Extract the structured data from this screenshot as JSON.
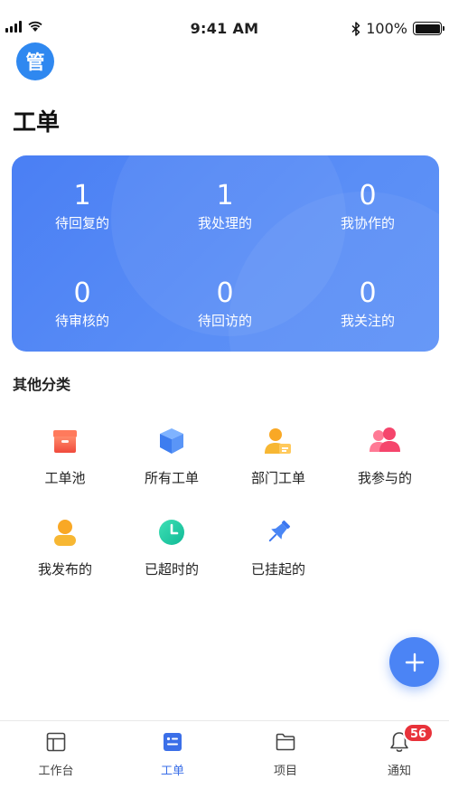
{
  "status_bar": {
    "time": "9:41 AM",
    "battery": "100%"
  },
  "avatar": {
    "text": "管"
  },
  "page": {
    "title": "工单"
  },
  "stats": [
    {
      "value": "1",
      "label": "待回复的"
    },
    {
      "value": "1",
      "label": "我处理的"
    },
    {
      "value": "0",
      "label": "我协作的"
    },
    {
      "value": "0",
      "label": "待审核的"
    },
    {
      "value": "0",
      "label": "待回访的"
    },
    {
      "value": "0",
      "label": "我关注的"
    }
  ],
  "other_section": {
    "title": "其他分类",
    "items": [
      {
        "label": "工单池",
        "icon": "box-icon"
      },
      {
        "label": "所有工单",
        "icon": "cube-icon"
      },
      {
        "label": "部门工单",
        "icon": "department-user-icon"
      },
      {
        "label": "我参与的",
        "icon": "people-icon"
      },
      {
        "label": "我发布的",
        "icon": "user-icon"
      },
      {
        "label": "已超时的",
        "icon": "clock-icon"
      },
      {
        "label": "已挂起的",
        "icon": "pin-icon"
      }
    ]
  },
  "fab": {
    "icon": "plus-icon"
  },
  "tabbar": {
    "items": [
      {
        "label": "工作台",
        "icon": "dashboard-icon"
      },
      {
        "label": "工单",
        "icon": "ticket-icon"
      },
      {
        "label": "项目",
        "icon": "folder-icon"
      },
      {
        "label": "通知",
        "icon": "bell-icon"
      }
    ],
    "notification_badge": "56"
  },
  "colors": {
    "primary": "#4a7ff4",
    "active_tab": "#3b6fe8",
    "badge": "#e8323a"
  }
}
